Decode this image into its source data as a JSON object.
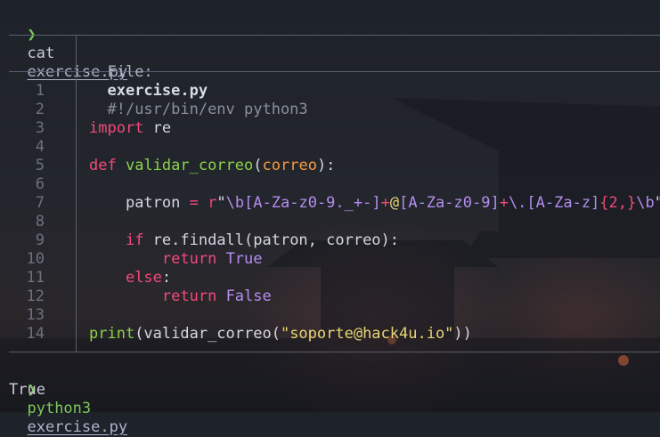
{
  "terminal": {
    "prompt_symbol": "❯",
    "first_command": {
      "program": "cat",
      "argument": "exercise.py"
    },
    "second_command": {
      "program": "python3",
      "argument": "exercise.py"
    },
    "output": "True"
  },
  "viewer": {
    "header_label": "File:",
    "header_file": "exercise.py"
  },
  "code": {
    "line_numbers": [
      "1",
      "2",
      "3",
      "4",
      "5",
      "6",
      "7",
      "8",
      "9",
      "10",
      "11",
      "12",
      "13",
      "14"
    ],
    "l1": "#!/usr/bin/env python3",
    "l3": {
      "kw": "import",
      "rest": " re"
    },
    "l5": {
      "kw": "def",
      "fn": "validar_correo",
      "open": "(",
      "param": "correo",
      "close": "):"
    },
    "l7": {
      "indent": "    ",
      "var": "patron",
      "eq": " = ",
      "prefix": "r",
      "q_open": "\"",
      "r1": "\\b[A-Za-z0-9._+-]",
      "plus1": "+",
      "at": "@",
      "r2": "[A-Za-z0-9]",
      "plus2": "+",
      "r3": "\\.[A-Za-z]",
      "r4": "{2,}",
      "r5": "\\b",
      "q_close": "\""
    },
    "l9": {
      "indent": "    ",
      "kw": "if",
      "rest": " re.findall(patron, correo):"
    },
    "l10": {
      "indent": "        ",
      "kw": "return",
      "bool": "True"
    },
    "l11": {
      "indent": "    ",
      "kw": "else",
      "rest": ":"
    },
    "l12": {
      "indent": "        ",
      "kw": "return",
      "bool": "False"
    },
    "l14": {
      "fn": "print",
      "open": "(validar_correo(",
      "str": "\"soporte@hack4u.io\"",
      "close": "))"
    }
  },
  "colors": {
    "keyword": "#f2497a",
    "function": "#8dd14a",
    "parameter": "#f79a43",
    "string": "#e8d574",
    "regex": "#b58cf0",
    "prompt": "#7ec85a"
  }
}
